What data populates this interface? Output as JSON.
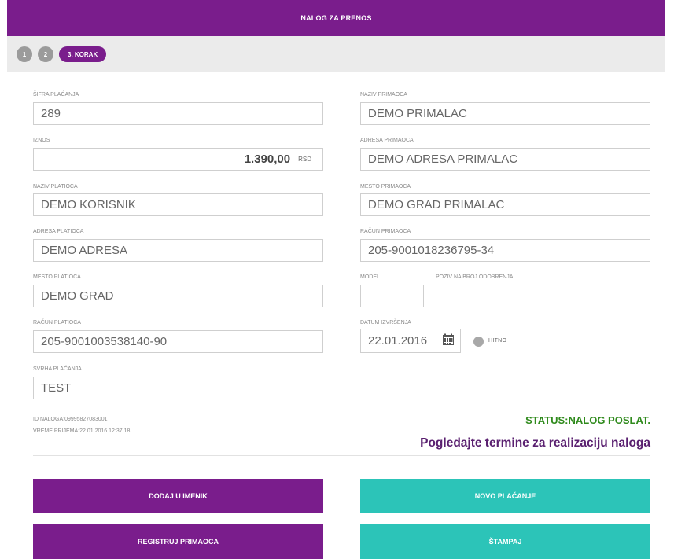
{
  "header": {
    "title": "NALOG ZA PRENOS"
  },
  "steps": {
    "step1": "1",
    "step2": "2",
    "step3": "3. KORAK"
  },
  "left": {
    "sifra_label": "ŠIFRA PLAĆANJA",
    "sifra_value": "289",
    "iznos_label": "IZNOS",
    "iznos_value": "1.390,00",
    "iznos_currency": "RSD",
    "naziv_platioca_label": "NAZIV PLATIOCA",
    "naziv_platioca_value": "DEMO KORISNIK",
    "adresa_platioca_label": "ADRESA PLATIOCA",
    "adresa_platioca_value": "DEMO ADRESA",
    "mesto_platioca_label": "MESTO PLATIOCA",
    "mesto_platioca_value": "DEMO GRAD",
    "racun_platioca_label": "RAČUN PLATIOCA",
    "racun_platioca_value": "205-9001003538140-90"
  },
  "right": {
    "naziv_primaoca_label": "NAZIV PRIMAOCA",
    "naziv_primaoca_value": "DEMO PRIMALAC",
    "adresa_primaoca_label": "ADRESA PRIMAOCA",
    "adresa_primaoca_value": "DEMO ADRESA PRIMALAC",
    "mesto_primaoca_label": "MESTO PRIMAOCA",
    "mesto_primaoca_value": "DEMO GRAD PRIMALAC",
    "racun_primaoca_label": "RAČUN PRIMAOCA",
    "racun_primaoca_value": "205-9001018236795-34",
    "model_label": "MODEL",
    "model_value": "",
    "poziv_label": "POZIV NA BROJ ODOBRENJA",
    "poziv_value": "",
    "datum_label": "DATUM IZVRŠENJA",
    "datum_value": "22.01.2016",
    "hitno_label": "HITNO"
  },
  "svrha": {
    "label": "SVRHA PLAĆANJA",
    "value": "TEST"
  },
  "info": {
    "id_naloga": "ID NALOGA:09995827083001",
    "vreme_prijema": "VREME PRIJEMA:22.01.2016 12:37:18",
    "status": "STATUS:NALOG POSLAT.",
    "termini_link": "Pogledajte termine za realizaciju naloga"
  },
  "buttons": {
    "dodaj": "DODAJ U IMENIK",
    "novo": "NOVO PLAĆANJE",
    "registruj": "REGISTRUJ PRIMAOCA",
    "stampaj": "ŠTAMPAJ"
  },
  "colors": {
    "brand": "#7a1d8c",
    "accent": "#2cc4b8",
    "status": "#2f8a1c"
  }
}
